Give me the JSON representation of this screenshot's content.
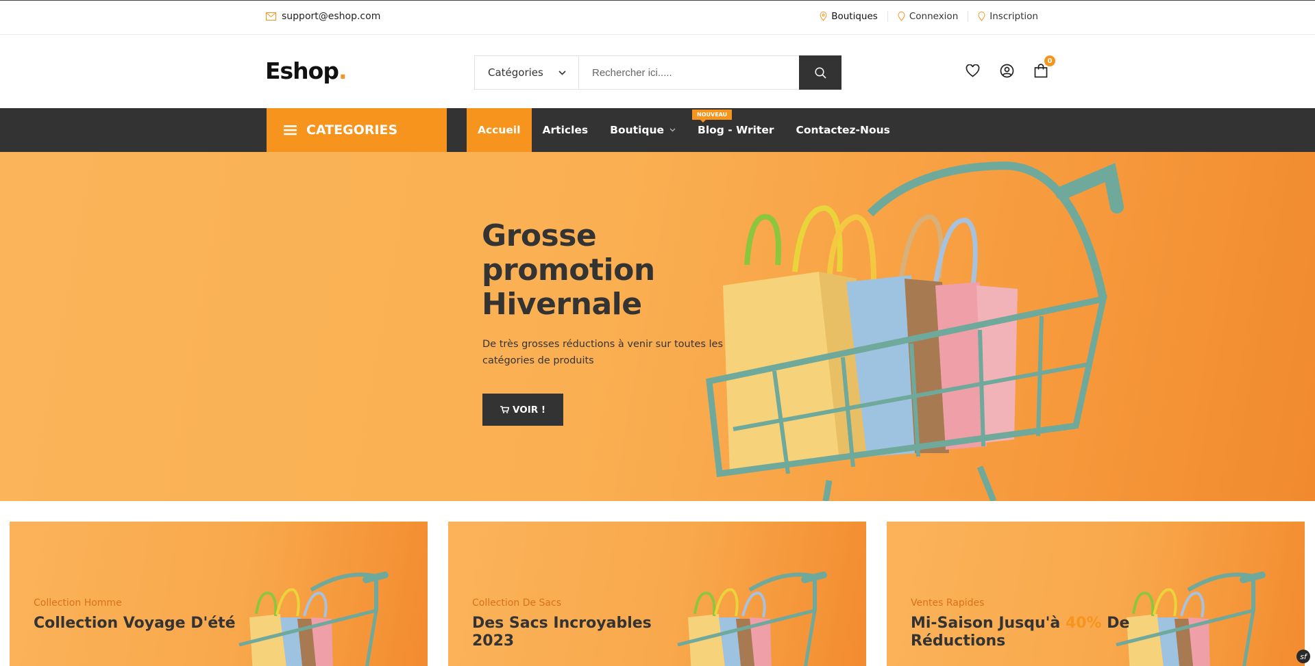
{
  "topbar": {
    "email": "support@eshop.com",
    "links": [
      {
        "label": "Boutiques",
        "icon": "map-pin-icon"
      },
      {
        "label": "Connexion",
        "icon": "map-pin-icon"
      },
      {
        "label": "Inscription",
        "icon": "map-pin-icon"
      }
    ]
  },
  "header": {
    "logo": "Eshop",
    "logo_dot": ".",
    "category_select": "Catégories",
    "search_placeholder": "Rechercher ici.....",
    "cart_count": "0",
    "icons": [
      "heart-icon",
      "user-icon",
      "bag-icon"
    ]
  },
  "nav": {
    "categories_label": "CATEGORIES",
    "items": [
      {
        "label": "Accueil",
        "active": true
      },
      {
        "label": "Articles"
      },
      {
        "label": "Boutique",
        "dropdown": true
      },
      {
        "label": "Blog - Writer",
        "tag": "NOUVEAU"
      },
      {
        "label": "Contactez-Nous"
      }
    ]
  },
  "hero": {
    "title_lines": [
      "Grosse",
      "promotion",
      "Hivernale"
    ],
    "subtitle": "De très grosses réductions à venir sur toutes les catégories de produits",
    "cta": "VOIR !"
  },
  "cards": [
    {
      "label": "Collection Homme",
      "title": "Collection Voyage D'été"
    },
    {
      "label": "Collection De Sacs",
      "title": "Des Sacs Incroyables 2023"
    },
    {
      "label": "Ventes Rapides",
      "title_before": "Mi-Saison Jusqu'à ",
      "title_highlight": "40%",
      "title_after": " De Réductions"
    }
  ],
  "colors": {
    "accent": "#f7941d",
    "dark": "#333333",
    "teal": "#6fa99b"
  }
}
